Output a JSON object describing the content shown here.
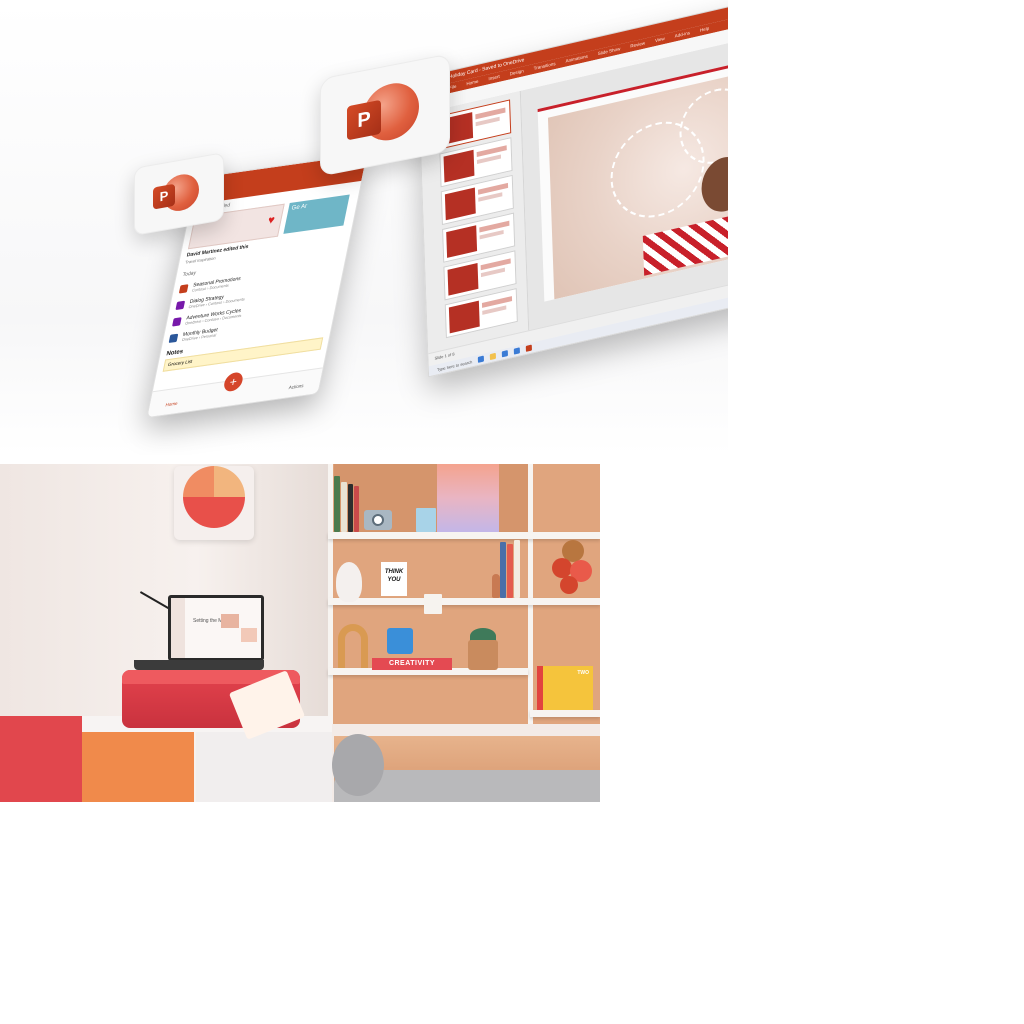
{
  "top_image": {
    "desktop": {
      "title": "Holiday Card - Saved to OneDrive",
      "tabs": [
        "File",
        "Home",
        "Insert",
        "Design",
        "Transitions",
        "Animations",
        "Slide Show",
        "Review",
        "View",
        "Add-ins",
        "Help"
      ],
      "status_text": "Slide 1 of 8",
      "taskbar_search": "Type here to search"
    },
    "phone": {
      "section_recommended": "Recommended",
      "rec_caption": "David Martinez edited this",
      "rec_sub": "Travel inspiration",
      "rec_card2_text": "Ge Ar",
      "section_today": "Today",
      "files": [
        {
          "name": "Seasonal Promotions",
          "meta": "Contoso › Documents",
          "kind": "powerpoint"
        },
        {
          "name": "Dialog Strategy",
          "meta": "OneDrive › Contoso › Documents",
          "kind": "onenote"
        },
        {
          "name": "Adventure Works Cycles",
          "meta": "OneDrive › Contoso › Documents",
          "kind": "onenote"
        },
        {
          "name": "Monthly Budget",
          "meta": "OneDrive › Personal",
          "kind": "word"
        }
      ],
      "notes_heading": "Notes",
      "note_text": "Grocery List",
      "see_all": "See all",
      "nav_home": "Home",
      "nav_actions": "Actions",
      "fab": "+"
    },
    "logo_letter": "P"
  },
  "bottom_image": {
    "laptop_slide_text": "Setting the Mood",
    "think_card": "THINK YOU",
    "creativity_label": "CREATIVITY",
    "book_label": "TWO"
  },
  "colors": {
    "ppt_orange": "#c43e1c",
    "accent_red": "#e1474d"
  }
}
